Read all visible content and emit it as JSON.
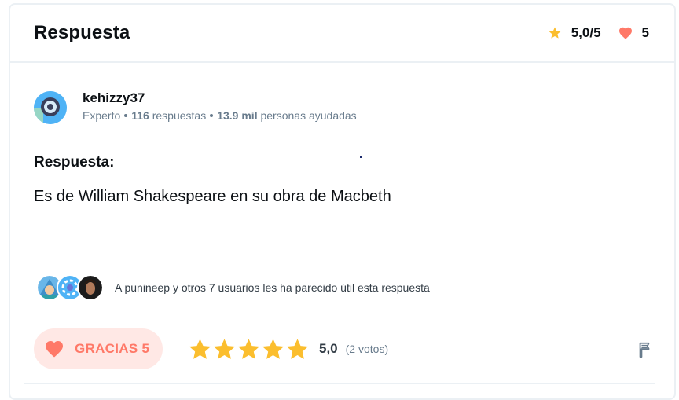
{
  "header": {
    "title": "Respuesta",
    "rating": "5,0/5",
    "likes": "5",
    "colors": {
      "star": "#fbbe2e",
      "heart": "#ff7968"
    }
  },
  "author": {
    "name": "kehizzy37",
    "rank": "Experto",
    "answers_count": "116",
    "answers_label": "respuestas",
    "helped_count": "13.9 mil",
    "helped_label": "personas ayudadas",
    "avatar_icon": "vinyl-record-avatar"
  },
  "answer": {
    "label": "Respuesta:",
    "text": "Es de William Shakespeare en su obra de Macbeth"
  },
  "helped": {
    "text": "A punineep y otros 7 usuarios les ha parecido útil esta respuesta",
    "avatars": [
      "user-avatar-1",
      "user-avatar-2",
      "user-avatar-3"
    ]
  },
  "actions": {
    "thanks_label": "GRACIAS 5",
    "rating_value": "5,0",
    "votes": "(2 votos)",
    "stars_filled": 5,
    "flag_icon": "flag-icon"
  }
}
